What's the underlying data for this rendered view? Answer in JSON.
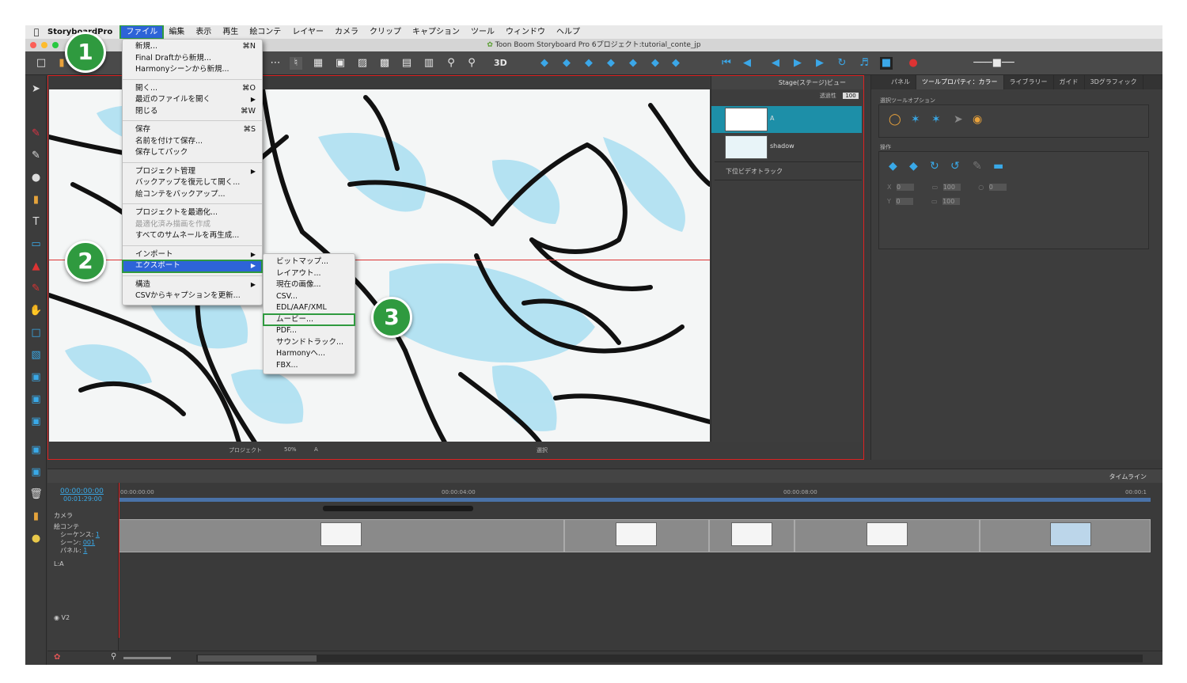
{
  "menubar": {
    "app_name": "StoryboardPro",
    "items": [
      "ファイル",
      "編集",
      "表示",
      "再生",
      "絵コンテ",
      "レイヤー",
      "カメラ",
      "クリップ",
      "キャプション",
      "ツール",
      "ウィンドウ",
      "ヘルプ"
    ]
  },
  "window": {
    "title": "Toon Boom Storyboard Pro 6プロジェクト:tutorial_conte_jp"
  },
  "file_menu": {
    "items": [
      {
        "label": "新規...",
        "shortcut": "⌘N"
      },
      {
        "label": "Final Draftから新規...",
        "shortcut": ""
      },
      {
        "label": "Harmonyシーンから新規...",
        "shortcut": ""
      },
      {
        "sep": true
      },
      {
        "label": "開く...",
        "shortcut": "⌘O"
      },
      {
        "label": "最近のファイルを開く",
        "arrow": "▶"
      },
      {
        "label": "閉じる",
        "shortcut": "⌘W"
      },
      {
        "sep": true
      },
      {
        "label": "保存",
        "shortcut": "⌘S"
      },
      {
        "label": "名前を付けて保存...",
        "shortcut": ""
      },
      {
        "label": "保存してパック",
        "shortcut": ""
      },
      {
        "sep": true
      },
      {
        "label": "プロジェクト管理",
        "arrow": "▶"
      },
      {
        "label": "バックアップを復元して開く...",
        "shortcut": ""
      },
      {
        "label": "絵コンテをバックアップ...",
        "shortcut": ""
      },
      {
        "sep": true
      },
      {
        "label": "プロジェクトを最適化...",
        "shortcut": ""
      },
      {
        "label": "最適化済み描画を作成",
        "disabled": true
      },
      {
        "label": "すべてのサムネールを再生成...",
        "shortcut": ""
      },
      {
        "sep": true
      },
      {
        "label": "インポート",
        "arrow": "▶"
      },
      {
        "label": "エクスポート",
        "arrow": "▶",
        "highlight": true
      },
      {
        "sep": true
      },
      {
        "label": "構造",
        "arrow": "▶"
      },
      {
        "label": "CSVからキャプションを更新...",
        "shortcut": ""
      }
    ]
  },
  "export_menu": {
    "items": [
      "ビットマップ...",
      "レイアウト...",
      "現在の画像...",
      "CSV...",
      "EDL/AAF/XML",
      "ムービー...",
      "PDF...",
      "サウンドトラック...",
      "Harmonyへ...",
      "FBX..."
    ],
    "highlighted_index": 5
  },
  "badges": [
    "1",
    "2",
    "3"
  ],
  "stage": {
    "panel_title": "Stage(ステージ)ビュー",
    "opacity_label": "透過性",
    "opacity_value": "100",
    "bottom": {
      "project": "プロジェクト",
      "zoom": "50%",
      "layer": "A",
      "selection": "選択"
    }
  },
  "layers": {
    "items": [
      {
        "name": "A",
        "selected": true
      },
      {
        "name": "shadow",
        "selected": false
      }
    ],
    "lower_track": "下位ビデオトラック"
  },
  "right_panel": {
    "tabs": [
      "パネル",
      "ツールプロパティ：カラー",
      "ライブラリー",
      "ガイド",
      "3Dグラフィック"
    ],
    "active_tab": 1,
    "section1": "選択ツールオプション",
    "section2": "操作",
    "fields": {
      "x": "0",
      "y": "0",
      "w": "100",
      "h": "100",
      "angle": "0"
    }
  },
  "timeline": {
    "title": "タイムライン",
    "current_time": "00:00:00:00",
    "total_time": "00:01:29:00",
    "ruler": [
      "00:00:00:00",
      "00:00:04:00",
      "00:00:08:00",
      "00:00:1"
    ],
    "camera_label": "カメラ",
    "storyboard_label": "絵コンテ",
    "sequence_label": "シーケンス:",
    "sequence_value": "1",
    "scene_label": "シーン:",
    "scene_value": "001",
    "panel_label": "パネル:",
    "panel_value": "1",
    "track_a": "L:A",
    "track_v2": "V2"
  },
  "colors": {
    "accent": "#2d64d8",
    "highlight_green": "#2f9a3f",
    "icon_blue": "#39a9e8",
    "stage_border": "#dd2222"
  }
}
